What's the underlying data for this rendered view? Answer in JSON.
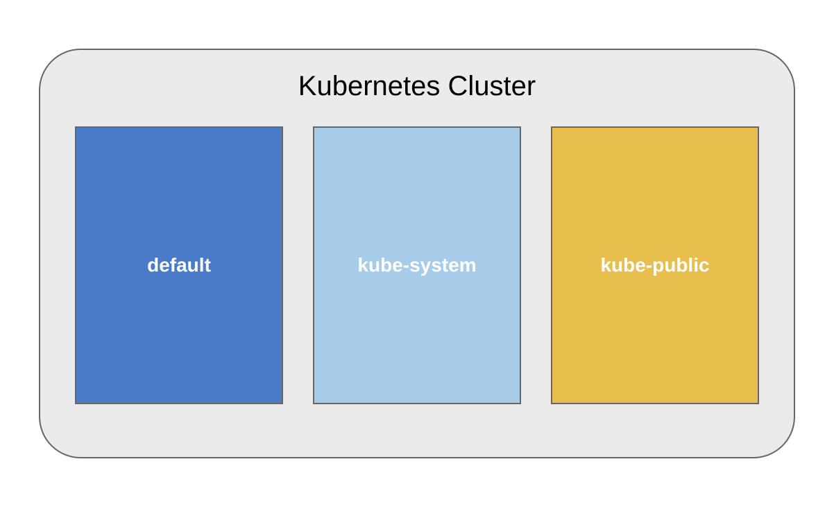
{
  "diagram": {
    "title": "Kubernetes Cluster",
    "namespaces": [
      {
        "label": "default",
        "color": "#4a7bc8"
      },
      {
        "label": "kube-system",
        "color": "#a7cce9"
      },
      {
        "label": "kube-public",
        "color": "#e8bf4d"
      }
    ]
  }
}
